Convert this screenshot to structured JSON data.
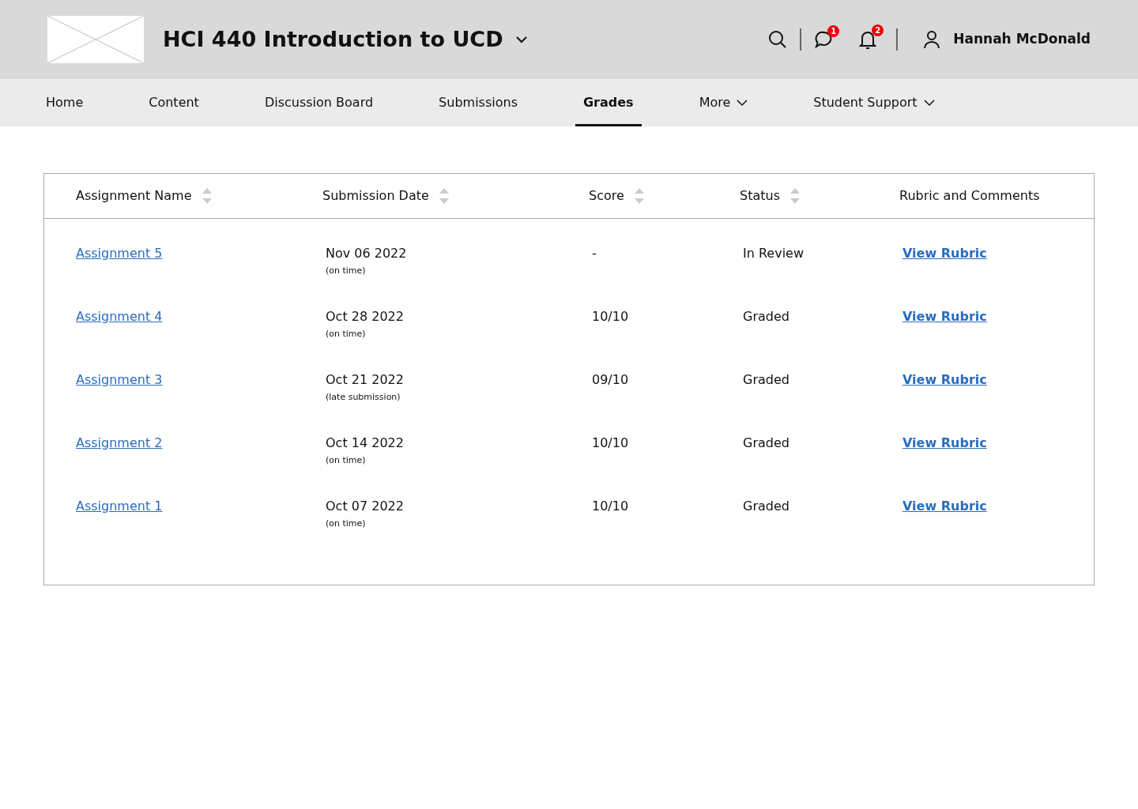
{
  "header": {
    "course_title": "HCI 440 Introduction to UCD",
    "messages_badge": "1",
    "notifications_badge": "2",
    "user_name": "Hannah McDonald"
  },
  "nav": [
    {
      "label": "Home",
      "selected": false,
      "dropdown": false
    },
    {
      "label": "Content",
      "selected": false,
      "dropdown": false
    },
    {
      "label": "Discussion Board",
      "selected": false,
      "dropdown": false
    },
    {
      "label": "Submissions",
      "selected": false,
      "dropdown": false
    },
    {
      "label": "Grades",
      "selected": true,
      "dropdown": false
    },
    {
      "label": "More",
      "selected": false,
      "dropdown": true
    },
    {
      "label": "Student Support",
      "selected": false,
      "dropdown": true
    }
  ],
  "table": {
    "columns": [
      {
        "label": "Assignment Name",
        "sortable": true
      },
      {
        "label": "Submission Date",
        "sortable": true
      },
      {
        "label": "Score",
        "sortable": true
      },
      {
        "label": "Status",
        "sortable": true
      },
      {
        "label": "Rubric and Comments",
        "sortable": false
      }
    ],
    "rows": [
      {
        "name": "Assignment 5",
        "date": "Nov 06 2022",
        "note": "(on time)",
        "score": "-",
        "status": "In Review",
        "rubric": "View Rubric"
      },
      {
        "name": "Assignment 4",
        "date": "Oct 28 2022",
        "note": "(on time)",
        "score": "10/10",
        "status": "Graded",
        "rubric": "View Rubric"
      },
      {
        "name": "Assignment 3",
        "date": "Oct 21 2022",
        "note": "(late submission)",
        "score": "09/10",
        "status": "Graded",
        "rubric": "View Rubric"
      },
      {
        "name": "Assignment 2",
        "date": "Oct 14 2022",
        "note": "(on time)",
        "score": "10/10",
        "status": "Graded",
        "rubric": "View Rubric"
      },
      {
        "name": "Assignment 1",
        "date": "Oct 07 2022",
        "note": "(on time)",
        "score": "10/10",
        "status": "Graded",
        "rubric": "View Rubric"
      }
    ]
  }
}
